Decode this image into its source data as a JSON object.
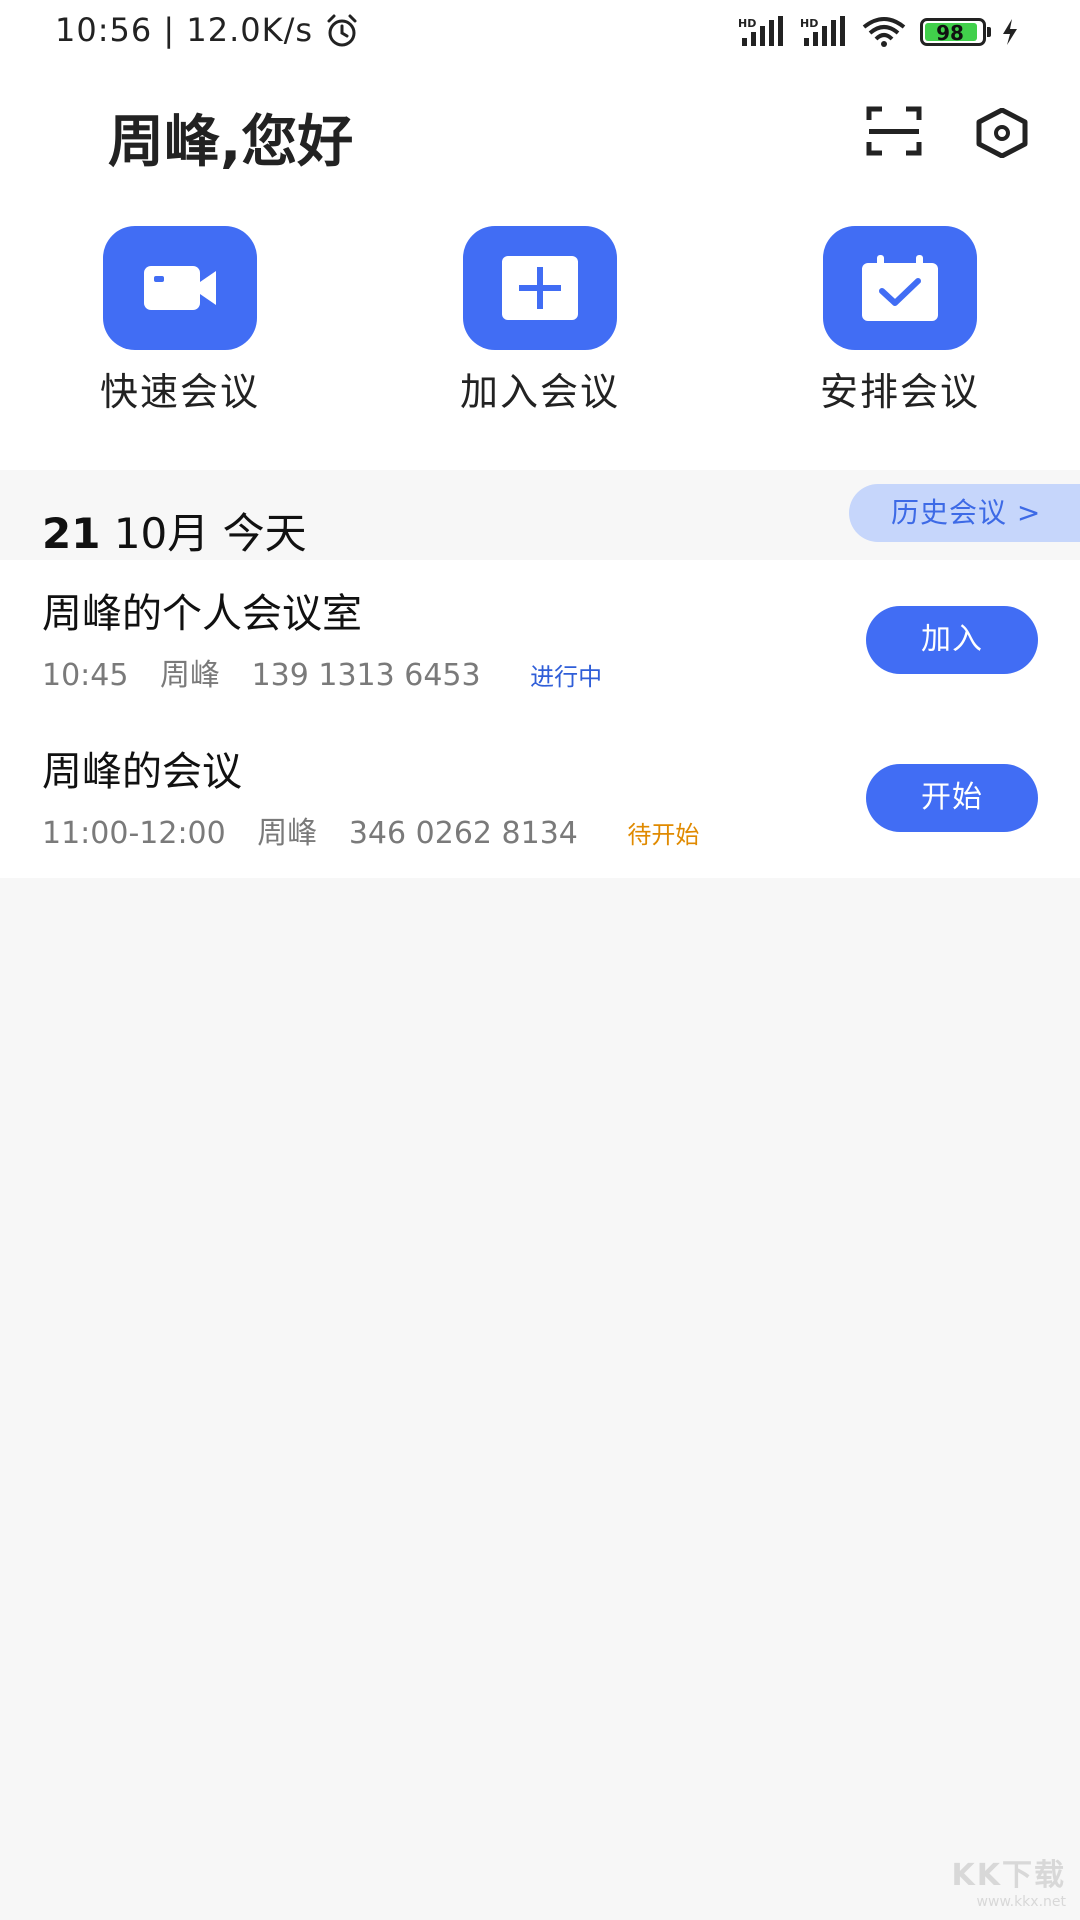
{
  "status_bar": {
    "time_speed": "10:56 | 12.0K/s",
    "battery": "98",
    "network_1": "HD",
    "network_2": "HD"
  },
  "header": {
    "greeting": "周峰,您好"
  },
  "actions": [
    {
      "label": "快速会议",
      "icon": "video-camera-icon"
    },
    {
      "label": "加入会议",
      "icon": "plus-icon"
    },
    {
      "label": "安排会议",
      "icon": "calendar-check-icon"
    }
  ],
  "date": {
    "day": "21",
    "rest": "10月  今天"
  },
  "history_button": "历史会议 >",
  "meetings": [
    {
      "title": "周峰的个人会议室",
      "time": "10:45",
      "host": "周峰",
      "number": "139 1313 6453",
      "status": "进行中",
      "button": "加入"
    },
    {
      "title": "周峰的会议",
      "time": "11:00-12:00",
      "host": "周峰",
      "number": "346 0262 8134",
      "status": "待开始",
      "button": "开始"
    }
  ],
  "watermark": {
    "logo": "KK下载",
    "url": "www.kkx.net"
  },
  "colors": {
    "accent": "#416df4",
    "history_bg": "#c6d6fb",
    "status_live": "#2f5ed8",
    "status_pending": "#e08a00",
    "battery_fill": "#41d04b"
  }
}
